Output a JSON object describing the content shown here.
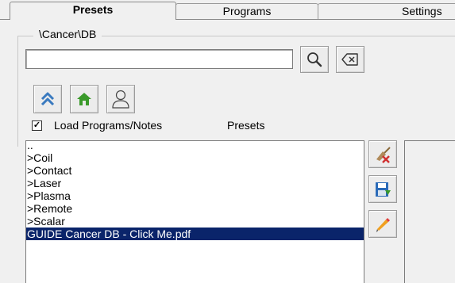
{
  "tabs": [
    {
      "label": "Presets",
      "active": true
    },
    {
      "label": "Programs",
      "active": false
    },
    {
      "label": "Settings",
      "active": false
    }
  ],
  "group": {
    "title": "\\Cancer\\DB"
  },
  "search": {
    "value": "",
    "placeholder": ""
  },
  "toolbar": {
    "search_icon": "magnifier-icon",
    "clear_icon": "clear-input-icon",
    "up_icon": "double-chevron-up-icon",
    "home_icon": "home-icon",
    "user_icon": "user-icon"
  },
  "options": {
    "load_checkbox_checked": true,
    "load_checkbox_mark": "✓",
    "load_label": "Load Programs/Notes",
    "presets_label": "Presets"
  },
  "list": {
    "items": [
      "..",
      ">Coil",
      ">Contact",
      ">Laser",
      ">Plasma",
      ">Remote",
      ">Scalar",
      "GUIDE Cancer DB - Click Me.pdf"
    ],
    "selected_index": 7
  },
  "side_buttons": {
    "clean_icon": "broom-delete-icon",
    "save_icon": "save-icon",
    "edit_icon": "pencil-icon"
  },
  "colors": {
    "selection": "#0a246a",
    "home_green": "#3a9a2a",
    "chevron_blue": "#3a7abf"
  }
}
